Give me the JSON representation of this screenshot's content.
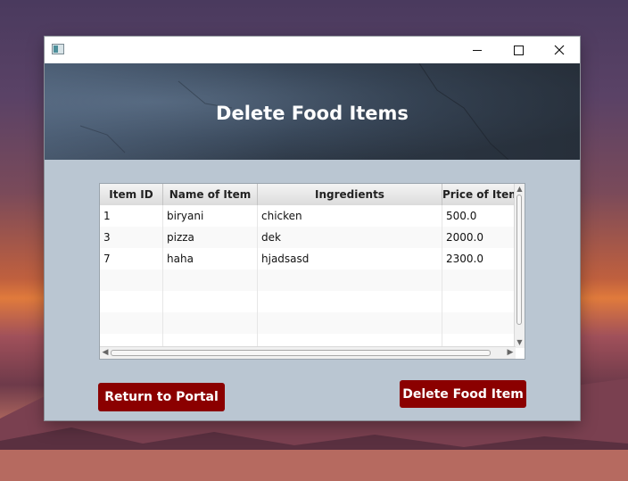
{
  "window": {
    "title": ""
  },
  "header": {
    "title": "Delete Food Items"
  },
  "table": {
    "columns": [
      "Item ID",
      "Name of Item",
      "Ingredients",
      "Price of Item"
    ],
    "rows": [
      [
        "1",
        "biryani",
        "chicken",
        "500.0"
      ],
      [
        "3",
        "pizza",
        "dek",
        "2000.0"
      ],
      [
        "7",
        "haha",
        "hjadsasd",
        "2300.0"
      ],
      [
        "",
        "",
        "",
        ""
      ],
      [
        "",
        "",
        "",
        ""
      ],
      [
        "",
        "",
        "",
        ""
      ],
      [
        "",
        "",
        "",
        ""
      ]
    ]
  },
  "buttons": {
    "return_label": "Return to Portal",
    "delete_label": "Delete Food Item"
  },
  "icons": {
    "app": "app-icon",
    "minimize": "minimize-icon",
    "maximize": "maximize-icon",
    "close": "close-icon",
    "scroll_up": "chevron-up-icon",
    "scroll_down": "chevron-down-icon",
    "scroll_left": "chevron-left-icon",
    "scroll_right": "chevron-right-icon"
  },
  "colors": {
    "accent_button": "#8b0000",
    "content_background": "#bac6d2"
  }
}
